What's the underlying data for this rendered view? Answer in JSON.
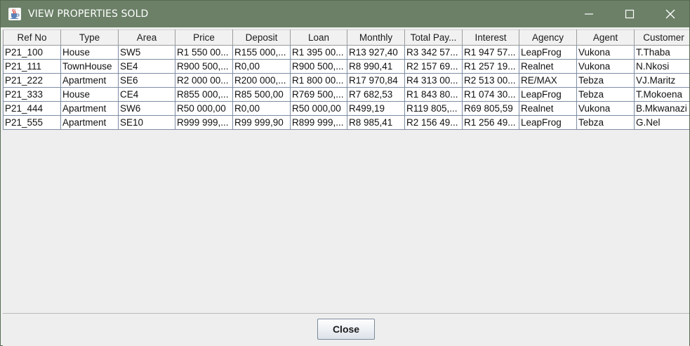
{
  "window": {
    "title": "VIEW PROPERTIES SOLD",
    "app_icon": "java-cup-icon",
    "controls": [
      "minimize-icon",
      "maximize-icon",
      "close-icon"
    ],
    "titlebar_color": "#6b8067"
  },
  "table": {
    "columns": [
      "Ref No",
      "Type",
      "Area",
      "Price",
      "Deposit",
      "Loan",
      "Monthly",
      "Total Pay...",
      "Interest",
      "Agency",
      "Agent",
      "Customer"
    ],
    "rows": [
      [
        "P21_100",
        "House",
        "SW5",
        "R1 550 00...",
        "R155 000,...",
        "R1 395 00...",
        "R13 927,40",
        "R3 342 57...",
        "R1 947 57...",
        "LeapFrog",
        "Vukona",
        "T.Thaba"
      ],
      [
        "P21_111",
        "TownHouse",
        "SE4",
        "R900 500,...",
        "R0,00",
        "R900 500,...",
        "R8 990,41",
        "R2 157 69...",
        "R1 257 19...",
        "Realnet",
        "Vukona",
        "N.Nkosi"
      ],
      [
        "P21_222",
        "Apartment",
        "SE6",
        "R2 000 00...",
        "R200 000,...",
        "R1 800 00...",
        "R17 970,84",
        "R4 313 00...",
        "R2 513 00...",
        "RE/MAX",
        "Tebza",
        "VJ.Maritz"
      ],
      [
        "P21_333",
        "House",
        "CE4",
        "R855 000,...",
        "R85 500,00",
        "R769 500,...",
        "R7 682,53",
        "R1 843 80...",
        "R1 074 30...",
        "LeapFrog",
        "Tebza",
        "T.Mokoena"
      ],
      [
        "P21_444",
        "Apartment",
        "SW6",
        "R50 000,00",
        "R0,00",
        "R50 000,00",
        "R499,19",
        "R119 805,...",
        "R69 805,59",
        "Realnet",
        "Vukona",
        "B.Mkwanazi"
      ],
      [
        "P21_555",
        "Apartment",
        "SE10",
        "R999 999,...",
        "R99 999,90",
        "R899 999,...",
        "R8 985,41",
        "R2 156 49...",
        "R1 256 49...",
        "LeapFrog",
        "Tebza",
        "G.Nel"
      ]
    ]
  },
  "footer": {
    "close_label": "Close"
  }
}
